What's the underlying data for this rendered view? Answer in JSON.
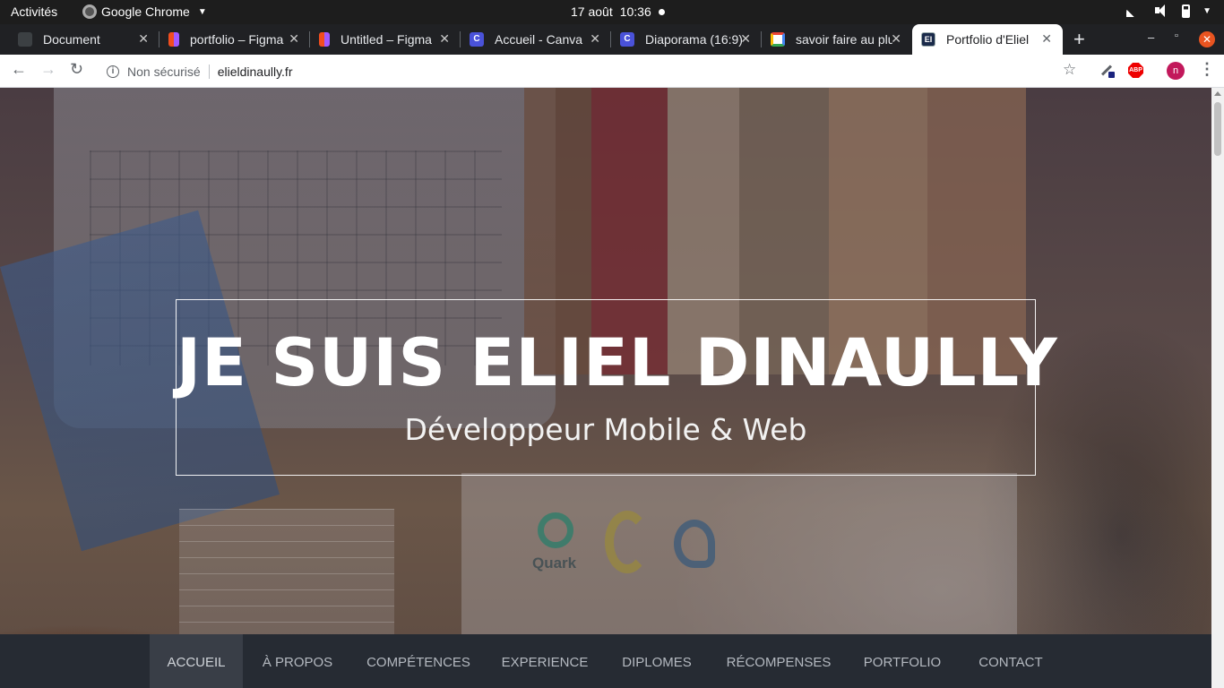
{
  "system": {
    "activities": "Activités",
    "app_name": "Google Chrome",
    "date": "17 août",
    "time": "10:36"
  },
  "tabs": [
    {
      "title": "Document",
      "icon": "document-favicon",
      "active": false
    },
    {
      "title": "portfolio – Figma",
      "icon": "figma-favicon",
      "active": false
    },
    {
      "title": "Untitled – Figma",
      "icon": "figma-favicon",
      "active": false
    },
    {
      "title": "Accueil - Canva",
      "icon": "canva-favicon",
      "active": false
    },
    {
      "title": "Diaporama (16:9)",
      "icon": "canva-favicon",
      "active": false
    },
    {
      "title": "savoir faire au pluriel",
      "icon": "google-favicon",
      "active": false
    },
    {
      "title": "Portfolio d'Eliel",
      "icon": "ed-favicon",
      "active": true
    }
  ],
  "omnibox": {
    "security": "Non sécurisé",
    "url": "elieldinaully.fr"
  },
  "profile": {
    "initial": "n",
    "color": "#c2185b"
  },
  "extensions": {
    "abp_label": "ABP"
  },
  "hero": {
    "title": "JE SUIS ELIEL DINAULLY",
    "subtitle": "Développeur Mobile & Web",
    "logo_text": "Quark"
  },
  "nav": {
    "items": [
      {
        "label": "ACCUEIL",
        "active": true
      },
      {
        "label": "À PROPOS",
        "active": false
      },
      {
        "label": "COMPÉTENCES",
        "active": false
      },
      {
        "label": "EXPERIENCE",
        "active": false
      },
      {
        "label": "DIPLOMES",
        "active": false
      },
      {
        "label": "RÉCOMPENSES",
        "active": false
      },
      {
        "label": "PORTFOLIO",
        "active": false
      },
      {
        "label": "CONTACT",
        "active": false
      }
    ],
    "background": "#262b33",
    "active_background": "#393e47"
  }
}
